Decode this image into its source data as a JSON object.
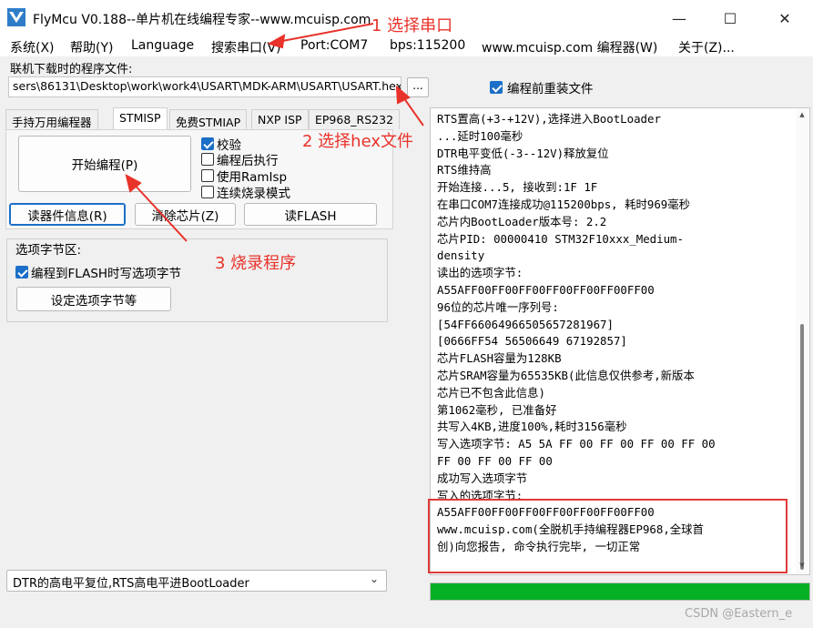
{
  "window": {
    "title": "FlyMcu V0.188--单片机在线编程专家--www.mcuisp.com",
    "minimize_glyph": "—",
    "maximize_glyph": "☐",
    "close_glyph": "✕",
    "app_icon": "flymcu-logo-icon"
  },
  "menu": {
    "items": [
      "系统(X)",
      "帮助(Y)",
      "Language",
      "搜索串口(V)",
      "Port:COM7",
      "bps:115200",
      "www.mcuisp.com 编程器(W)",
      "关于(Z)..."
    ]
  },
  "file": {
    "label": "联机下载时的程序文件:",
    "path": "sers\\86131\\Desktop\\work\\work4\\USART\\MDK-ARM\\USART\\USART.hex",
    "browse_label": "...",
    "reload_label": "编程前重装文件",
    "reload_checked": true
  },
  "tabs": [
    "手持万用编程器",
    "STMISP",
    "免费STMIAP",
    "NXP ISP",
    "EP968_RS232"
  ],
  "stmisp": {
    "start_button": "开始编程(P)",
    "options": [
      {
        "label": "校验",
        "checked": true
      },
      {
        "label": "编程后执行",
        "checked": false
      },
      {
        "label": "使用RamIsp",
        "checked": false
      },
      {
        "label": "连续烧录模式",
        "checked": false
      }
    ],
    "read_info_button": "读器件信息(R)",
    "erase_button": "清除芯片(Z)",
    "read_flash_button": "读FLASH"
  },
  "option_bytes": {
    "group_title": "选项字节区:",
    "write_label": "编程到FLASH时写选项字节",
    "write_checked": true,
    "settings_button": "设定选项字节等"
  },
  "reset_mode": {
    "selected": "DTR的高电平复位,RTS高电平进BootLoader"
  },
  "log_lines": [
    "RTS置高(+3-+12V),选择进入BootLoader",
    "...延时100毫秒",
    "DTR电平变低(-3--12V)释放复位",
    "RTS维持高",
    "开始连接...5, 接收到:1F 1F",
    "在串口COM7连接成功@115200bps, 耗时969毫秒",
    "芯片内BootLoader版本号: 2.2",
    "芯片PID: 00000410  STM32F10xxx_Medium-",
    "density",
    "读出的选项字节:",
    "A55AFF00FF00FF00FF00FF00FF00FF00",
    "96位的芯片唯一序列号:",
    "[54FF66064966505657281967]",
    "[0666FF54 56506649 67192857]",
    "芯片FLASH容量为128KB",
    "芯片SRAM容量为65535KB(此信息仅供参考,新版本",
    "芯片已不包含此信息)",
    "第1062毫秒, 已准备好",
    "共写入4KB,进度100%,耗时3156毫秒",
    "写入选项字节:  A5 5A FF 00 FF 00 FF 00 FF 00",
    "FF 00 FF 00 FF 00",
    "成功写入选项字节",
    "写入的选项字节:",
    "A55AFF00FF00FF00FF00FF00FF00FF00",
    "www.mcuisp.com(全脱机手持编程器EP968,全球首",
    "创)向您报告, 命令执行完毕, 一切正常"
  ],
  "progress_fraction": 1.0,
  "annotations": {
    "step1": "1 选择串口",
    "step2": "2 选择hex文件",
    "step3": "3 烧录程序",
    "color": "#e8322a"
  },
  "watermark": "CSDN @Eastern_e",
  "colors": {
    "accent": "#1b6fc8",
    "progress": "#06b025",
    "annotation": "#e8322a"
  }
}
